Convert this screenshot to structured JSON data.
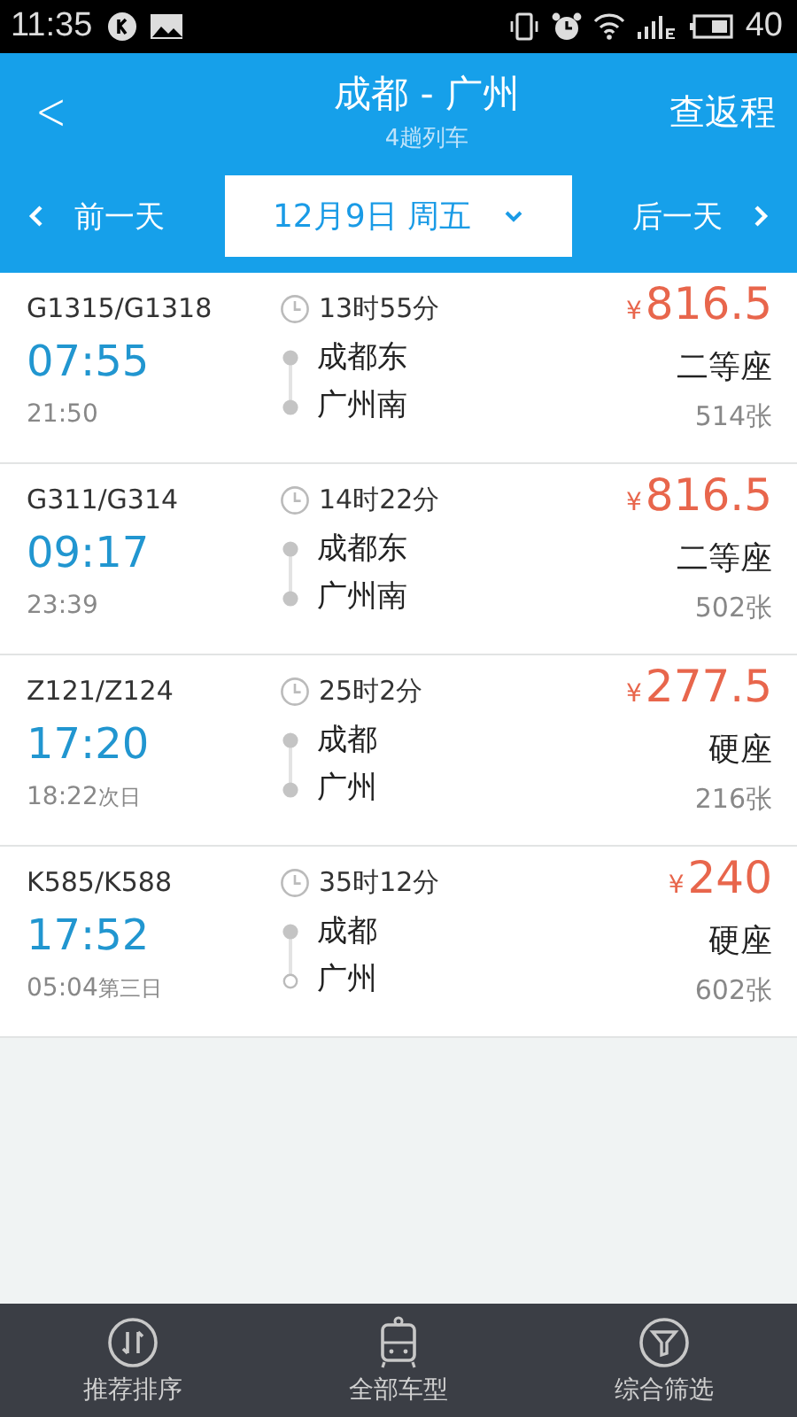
{
  "status_bar": {
    "time": "11:35",
    "battery": "40"
  },
  "header": {
    "back": "<",
    "title": "成都 - 广州",
    "subtitle": "4趟列车",
    "action": "查返程"
  },
  "date_bar": {
    "prev": "前一天",
    "date": "12月9日 周五",
    "next": "后一天"
  },
  "trains": [
    {
      "number": "G1315/G1318",
      "depart": "07:55",
      "arrive": "21:50",
      "duration": "13时55分",
      "from": "成都东",
      "to": "广州南",
      "arrival_hollow": false,
      "price": "816.5",
      "currency": "¥",
      "seat": "二等座",
      "tickets": "514张"
    },
    {
      "number": "G311/G314",
      "depart": "09:17",
      "arrive": "23:39",
      "duration": "14时22分",
      "from": "成都东",
      "to": "广州南",
      "arrival_hollow": false,
      "price": "816.5",
      "currency": "¥",
      "seat": "二等座",
      "tickets": "502张"
    },
    {
      "number": "Z121/Z124",
      "depart": "17:20",
      "arrive": "18:22",
      "arrive_note": "次日",
      "duration": "25时2分",
      "from": "成都",
      "to": "广州",
      "arrival_hollow": false,
      "price": "277.5",
      "currency": "¥",
      "seat": "硬座",
      "tickets": "216张"
    },
    {
      "number": "K585/K588",
      "depart": "17:52",
      "arrive": "05:04",
      "arrive_note": "第三日",
      "duration": "35时12分",
      "from": "成都",
      "to": "广州",
      "arrival_hollow": true,
      "price": "240",
      "currency": "¥",
      "seat": "硬座",
      "tickets": "602张"
    }
  ],
  "bottom_tabs": [
    {
      "kind": "sort",
      "label": "推荐排序"
    },
    {
      "kind": "train",
      "label": "全部车型"
    },
    {
      "kind": "filter",
      "label": "综合筛选"
    }
  ]
}
